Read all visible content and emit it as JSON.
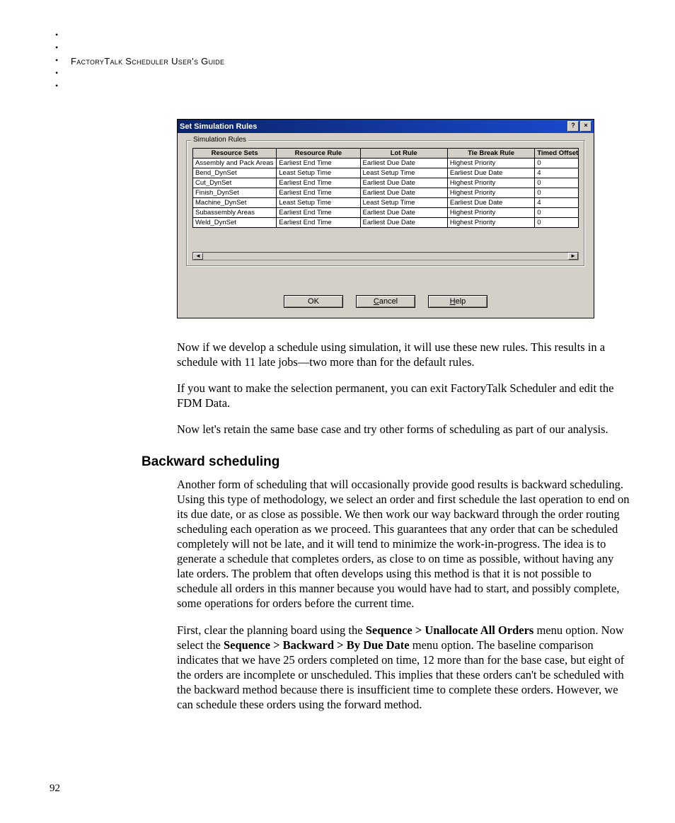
{
  "header": {
    "title": "FactoryTalk Scheduler User's Guide"
  },
  "dialog": {
    "title": "Set Simulation Rules",
    "group_label": "Simulation Rules",
    "columns": {
      "resource_sets": "Resource Sets",
      "resource_rule": "Resource Rule",
      "lot_rule": "Lot Rule",
      "tie_break_rule": "Tie Break Rule",
      "timed_offset": "Timed Offset"
    },
    "rows": [
      {
        "rs": "Assembly and Pack Areas",
        "rr": "Earliest End Time",
        "lr": "Earliest Due Date",
        "tb": "Highest Priority",
        "to": "0"
      },
      {
        "rs": "Bend_DynSet",
        "rr": "Least Setup Time",
        "lr": "Least Setup Time",
        "tb": "Earliest Due Date",
        "to": "4"
      },
      {
        "rs": "Cut_DynSet",
        "rr": "Earliest End Time",
        "lr": "Earliest Due Date",
        "tb": "Highest Priority",
        "to": "0"
      },
      {
        "rs": "Finish_DynSet",
        "rr": "Earliest End Time",
        "lr": "Earliest Due Date",
        "tb": "Highest Priority",
        "to": "0"
      },
      {
        "rs": "Machine_DynSet",
        "rr": "Least Setup Time",
        "lr": "Least Setup Time",
        "tb": "Earliest Due Date",
        "to": "4"
      },
      {
        "rs": "Subassembly Areas",
        "rr": "Earliest End Time",
        "lr": "Earliest Due Date",
        "tb": "Highest Priority",
        "to": "0"
      },
      {
        "rs": "Weld_DynSet",
        "rr": "Earliest End Time",
        "lr": "Earliest Due Date",
        "tb": "Highest Priority",
        "to": "0"
      }
    ],
    "buttons": {
      "ok": "OK",
      "cancel": "Cancel",
      "help": "Help"
    },
    "titlebar_btn_help": "?",
    "titlebar_btn_close": "×"
  },
  "paragraphs": {
    "p1": "Now if we develop a schedule using simulation, it will use these new rules. This results in a schedule with 11 late jobs—two more than for the default rules.",
    "p2": "If you want to make the selection permanent, you can exit FactoryTalk Scheduler and edit the FDM Data.",
    "p3": "Now let's retain the same base case and try other forms of scheduling as part of our analysis."
  },
  "section": {
    "heading": "Backward scheduling",
    "p4": "Another form of scheduling that will occasionally provide good results is backward scheduling. Using this type of methodology, we select an order and first schedule the last operation to end on its due date, or as close as possible. We then work our way backward through the order routing scheduling each operation as we proceed. This guarantees that any order that can be scheduled completely will not be late, and it will tend to minimize the work-in-progress. The idea is to generate a schedule that completes orders, as close to on time as possible, without having any late orders. The problem that often develops using this method is that it is not possible to schedule all orders in this manner because you would have had to start, and possibly complete, some operations for orders before the current time.",
    "p5_pre": "First, clear the planning board using the ",
    "p5_bold1": "Sequence > Unallocate All Orders",
    "p5_mid1": " menu option. Now select the ",
    "p5_bold2": "Sequence > Backward > By Due Date",
    "p5_mid2": " menu option. The baseline comparison indicates that we have 25 orders completed on time, 12 more than for the base case, but eight of the orders are incomplete or unscheduled. This implies that these orders can't be scheduled with the backward method because there is insufficient time to complete these orders. However, we can schedule these orders using the forward method."
  },
  "page_number": "92"
}
